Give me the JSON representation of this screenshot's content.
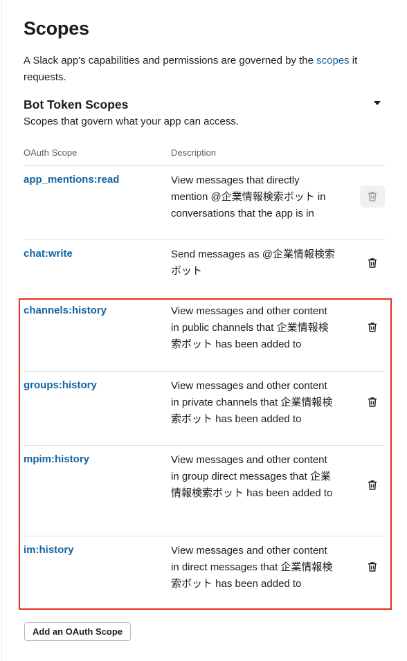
{
  "page": {
    "title": "Scopes",
    "intro_prefix": "A Slack app's capabilities and permissions are governed by the ",
    "intro_link": "scopes",
    "intro_suffix": " it requests."
  },
  "bot_token_scopes": {
    "title": "Bot Token Scopes",
    "subtitle": "Scopes that govern what your app can access.",
    "columns": {
      "scope": "OAuth Scope",
      "description": "Description"
    },
    "rows": [
      {
        "scope": "app_mentions:read",
        "description": "View messages that directly mention @企業情報検索ボット in conversations that the app is in"
      },
      {
        "scope": "chat:write",
        "description": "Send messages as @企業情報検索ボット"
      },
      {
        "scope": "channels:history",
        "description": "View messages and other content in public channels that 企業情報検索ボット has been added to"
      },
      {
        "scope": "groups:history",
        "description": "View messages and other content in private channels that 企業情報検索ボット has been added to"
      },
      {
        "scope": "mpim:history",
        "description": "View messages and other content in group direct messages that 企業情報検索ボット has been added to"
      },
      {
        "scope": "im:history",
        "description": "View messages and other content in direct messages that 企業情報検索ボット has been added to"
      }
    ],
    "add_button_label": "Add an OAuth Scope"
  },
  "colors": {
    "link": "#1264a3",
    "highlight": "#e52d1d",
    "text": "#1d1c1d"
  },
  "icons": {
    "row_action": "trash-icon",
    "collapse": "caret-down-icon"
  }
}
